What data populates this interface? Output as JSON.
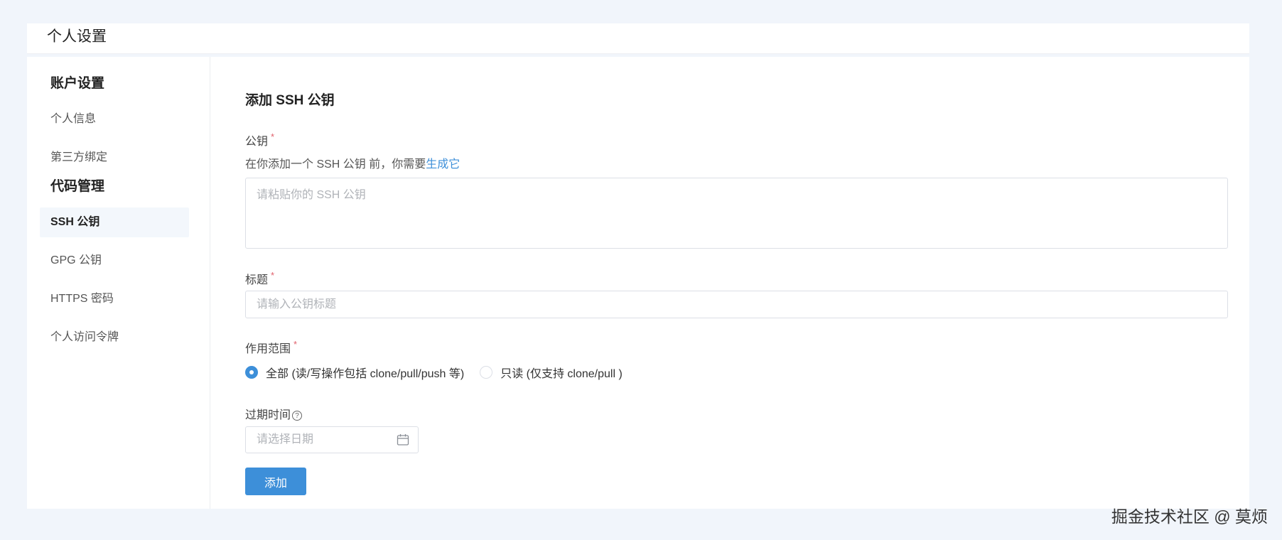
{
  "header": {
    "title": "个人设置"
  },
  "sidebar": {
    "groups": [
      {
        "title": "账户设置",
        "items": [
          {
            "label": "个人信息"
          },
          {
            "label": "第三方绑定"
          }
        ]
      },
      {
        "title": "代码管理",
        "items": [
          {
            "label": "SSH 公钥",
            "active": true
          },
          {
            "label": "GPG 公钥"
          },
          {
            "label": "HTTPS 密码"
          },
          {
            "label": "个人访问令牌"
          }
        ]
      }
    ]
  },
  "form": {
    "title": "添加 SSH 公钥",
    "public_key": {
      "label": "公钥",
      "required_mark": "*",
      "hint_prefix": "在你添加一个 SSH 公钥 前，你需要",
      "hint_link": "生成它",
      "placeholder": "请粘贴你的 SSH 公钥"
    },
    "key_title": {
      "label": "标题",
      "required_mark": "*",
      "placeholder": "请输入公钥标题"
    },
    "scope": {
      "label": "作用范围",
      "required_mark": "*",
      "options": [
        {
          "label": "全部 (读/写操作包括 clone/pull/push 等)",
          "checked": true
        },
        {
          "label": "只读 (仅支持 clone/pull )",
          "checked": false
        }
      ]
    },
    "expire": {
      "label": "过期时间",
      "help_icon": "?",
      "placeholder": "请选择日期"
    },
    "submit_label": "添加"
  },
  "colors": {
    "accent": "#3d8fd9",
    "required": "#e0606b",
    "page_bg": "#f1f5fb"
  },
  "watermark": "掘金技术社区 @ 莫烦"
}
